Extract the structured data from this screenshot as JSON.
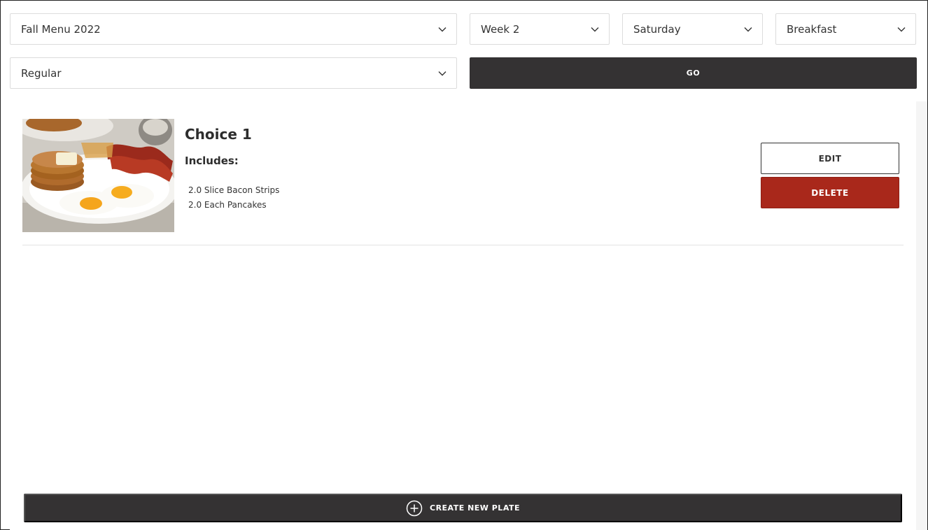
{
  "filters": {
    "menu": "Fall Menu 2022",
    "week": "Week 2",
    "day": "Saturday",
    "meal": "Breakfast",
    "diet": "Regular"
  },
  "actions": {
    "go_label": "GO",
    "create_label": "CREATE NEW PLATE"
  },
  "plates": [
    {
      "title": "Choice 1",
      "includes_label": "Includes:",
      "items": [
        "2.0 Slice Bacon Strips",
        "2.0 Each Pancakes"
      ],
      "edit_label": "EDIT",
      "delete_label": "DELETE"
    }
  ],
  "icons": {
    "dropdown": "chevron-down-icon",
    "create": "plus-circle-icon"
  },
  "colors": {
    "dark_button": "#343233",
    "delete_button": "#a9281b"
  }
}
